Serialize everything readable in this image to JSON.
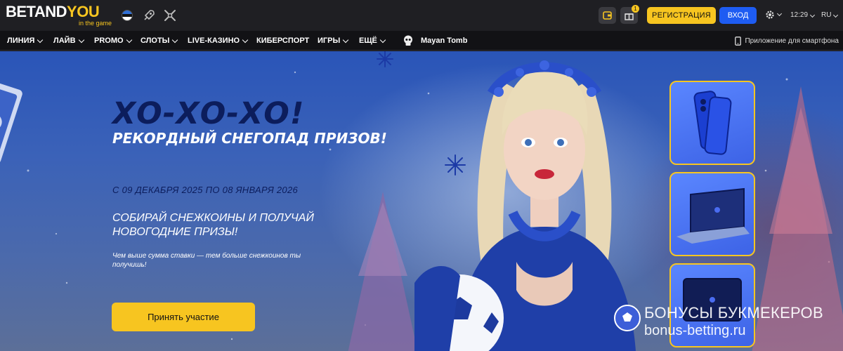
{
  "brand": {
    "logo_part1": "BETAND",
    "logo_part2": "YOU",
    "tagline": "in the game"
  },
  "header": {
    "register_label": "РЕГИСТРАЦИЯ",
    "login_label": "ВХОД",
    "time": "12:29",
    "language": "RU",
    "gift_badge": "1"
  },
  "nav": {
    "items": [
      {
        "label": "ЛИНИЯ",
        "dropdown": true
      },
      {
        "label": "ЛАЙВ",
        "dropdown": true
      },
      {
        "label": "PROMO",
        "dropdown": true
      },
      {
        "label": "СЛОТЫ",
        "dropdown": true
      },
      {
        "label": "LIVE-КАЗИНО",
        "dropdown": true
      },
      {
        "label": "КИБЕРСПОРТ",
        "dropdown": false
      },
      {
        "label": "ИГРЫ",
        "dropdown": true
      },
      {
        "label": "ЕЩЁ",
        "dropdown": true
      }
    ],
    "featured_game": "Mayan Tomb",
    "app_link": "Приложение для смартфона"
  },
  "hero": {
    "title": "ХО-ХО-ХО!",
    "subtitle": "РЕКОРДНЫЙ СНЕГОПАД ПРИЗОВ!",
    "dates": "С 09 ДЕКАБРЯ 2025 ПО 08 ЯНВАРЯ 2026",
    "collect": "СОБИРАЙ СНЕЖКОИНЫ И ПОЛУЧАЙ НОВОГОДНИЕ ПРИЗЫ!",
    "note": "Чем выше сумма ставки — тем больше снежкоинов ты получишь!",
    "cta_label": "Принять участие"
  },
  "prizes": [
    {
      "icon": "smartphone-icon"
    },
    {
      "icon": "laptop-icon"
    },
    {
      "icon": "tablet-icon"
    }
  ],
  "watermark": {
    "title": "БОНУСЫ БУКМЕКЕРОВ",
    "url": "bonus-betting.ru"
  },
  "colors": {
    "accent_yellow": "#f7c520",
    "login_blue": "#1e5cf2",
    "topbar": "#1f1f23",
    "navbar": "#121215",
    "hero_title": "#0c1d5c"
  }
}
